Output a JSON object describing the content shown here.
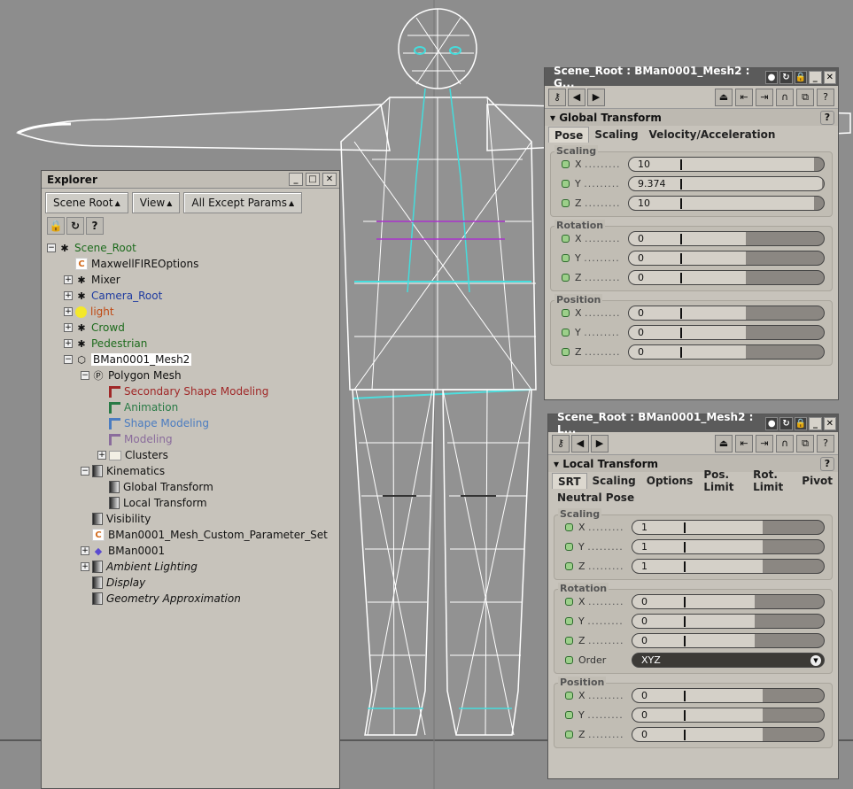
{
  "colors": {
    "annotation": "#f4ea1a",
    "wire": "#ffffff",
    "panel": "#c7c3bb"
  },
  "explorer": {
    "title": "Explorer",
    "toolbar": {
      "scene_root": "Scene Root",
      "view": "View",
      "filter": "All Except Params"
    },
    "icons": [
      "lock-icon",
      "refresh-icon",
      "help-icon"
    ],
    "tree": [
      {
        "label": "Scene_Root",
        "depth": 0,
        "exp": "−",
        "icon": "figure",
        "cls": "green"
      },
      {
        "label": "MaxwellFIREOptions",
        "depth": 1,
        "exp": "",
        "icon": "c",
        "cls": ""
      },
      {
        "label": "Mixer",
        "depth": 1,
        "exp": "+",
        "icon": "figure",
        "cls": ""
      },
      {
        "label": "Camera_Root",
        "depth": 1,
        "exp": "+",
        "icon": "figure",
        "cls": "blue"
      },
      {
        "label": "light",
        "depth": 1,
        "exp": "+",
        "icon": "bulb",
        "cls": "orange"
      },
      {
        "label": "Crowd",
        "depth": 1,
        "exp": "+",
        "icon": "figure",
        "cls": "green"
      },
      {
        "label": "Pedestrian",
        "depth": 1,
        "exp": "+",
        "icon": "figure",
        "cls": "green"
      },
      {
        "label": "BMan0001_Mesh2",
        "depth": 1,
        "exp": "−",
        "icon": "mesh",
        "cls": "sel"
      },
      {
        "label": "Polygon Mesh",
        "depth": 2,
        "exp": "−",
        "icon": "p",
        "cls": ""
      },
      {
        "label": "Secondary Shape Modeling",
        "depth": 3,
        "exp": "",
        "icon": "shape-red",
        "cls": "red"
      },
      {
        "label": "Animation",
        "depth": 3,
        "exp": "",
        "icon": "shape-teal",
        "cls": "teal"
      },
      {
        "label": "Shape Modeling",
        "depth": 3,
        "exp": "",
        "icon": "shape-blue",
        "cls": "lblue"
      },
      {
        "label": "Modeling",
        "depth": 3,
        "exp": "",
        "icon": "shape-purple",
        "cls": "purple"
      },
      {
        "label": "Clusters",
        "depth": 3,
        "exp": "+",
        "icon": "folder",
        "cls": ""
      },
      {
        "label": "Kinematics",
        "depth": 2,
        "exp": "−",
        "icon": "grad",
        "cls": ""
      },
      {
        "label": "Global Transform",
        "depth": 3,
        "exp": "",
        "icon": "grad",
        "cls": ""
      },
      {
        "label": "Local Transform",
        "depth": 3,
        "exp": "",
        "icon": "grad",
        "cls": ""
      },
      {
        "label": "Visibility",
        "depth": 2,
        "exp": "",
        "icon": "grad",
        "cls": ""
      },
      {
        "label": "BMan0001_Mesh_Custom_Parameter_Set",
        "depth": 2,
        "exp": "",
        "icon": "c",
        "cls": ""
      },
      {
        "label": "BMan0001",
        "depth": 2,
        "exp": "+",
        "icon": "gem",
        "cls": ""
      },
      {
        "label": "Ambient Lighting",
        "depth": 2,
        "exp": "+",
        "icon": "grad",
        "cls": "ital"
      },
      {
        "label": "Display",
        "depth": 2,
        "exp": "",
        "icon": "grad",
        "cls": "ital"
      },
      {
        "label": "Geometry Approximation",
        "depth": 2,
        "exp": "",
        "icon": "grad",
        "cls": "ital"
      }
    ]
  },
  "global_panel": {
    "title": "Scene_Root : BMan0001_Mesh2 : G...",
    "section": "Global Transform",
    "tabs": [
      "Pose",
      "Scaling",
      "Velocity/Acceleration"
    ],
    "groups": [
      {
        "name": "Scaling",
        "rows": [
          {
            "axis": "X",
            "value": "10",
            "fill": 0.95
          },
          {
            "axis": "Y",
            "value": "9.374",
            "fill": 0.99
          },
          {
            "axis": "Z",
            "value": "10",
            "fill": 0.95
          }
        ]
      },
      {
        "name": "Rotation",
        "rows": [
          {
            "axis": "X",
            "value": "0",
            "fill": 0.6
          },
          {
            "axis": "Y",
            "value": "0",
            "fill": 0.6
          },
          {
            "axis": "Z",
            "value": "0",
            "fill": 0.6
          }
        ]
      },
      {
        "name": "Position",
        "rows": [
          {
            "axis": "X",
            "value": "0",
            "fill": 0.6
          },
          {
            "axis": "Y",
            "value": "0",
            "fill": 0.6
          },
          {
            "axis": "Z",
            "value": "0",
            "fill": 0.6
          }
        ]
      }
    ]
  },
  "local_panel": {
    "title": "Scene_Root : BMan0001_Mesh2 : L...",
    "section": "Local Transform",
    "tabs": [
      "SRT",
      "Scaling",
      "Options",
      "Pos. Limit",
      "Rot. Limit",
      "Pivot"
    ],
    "tab2": "Neutral Pose",
    "order_label": "Order",
    "order_value": "XYZ",
    "groups": [
      {
        "name": "Scaling",
        "rows": [
          {
            "axis": "X",
            "value": "1",
            "fill": 0.68
          },
          {
            "axis": "Y",
            "value": "1",
            "fill": 0.68
          },
          {
            "axis": "Z",
            "value": "1",
            "fill": 0.68
          }
        ]
      },
      {
        "name": "Rotation",
        "rows": [
          {
            "axis": "X",
            "value": "0",
            "fill": 0.64
          },
          {
            "axis": "Y",
            "value": "0",
            "fill": 0.64
          },
          {
            "axis": "Z",
            "value": "0",
            "fill": 0.64
          }
        ]
      },
      {
        "name": "Position",
        "rows": [
          {
            "axis": "X",
            "value": "0",
            "fill": 0.68
          },
          {
            "axis": "Y",
            "value": "0",
            "fill": 0.68
          },
          {
            "axis": "Z",
            "value": "0",
            "fill": 0.68
          }
        ]
      }
    ]
  }
}
